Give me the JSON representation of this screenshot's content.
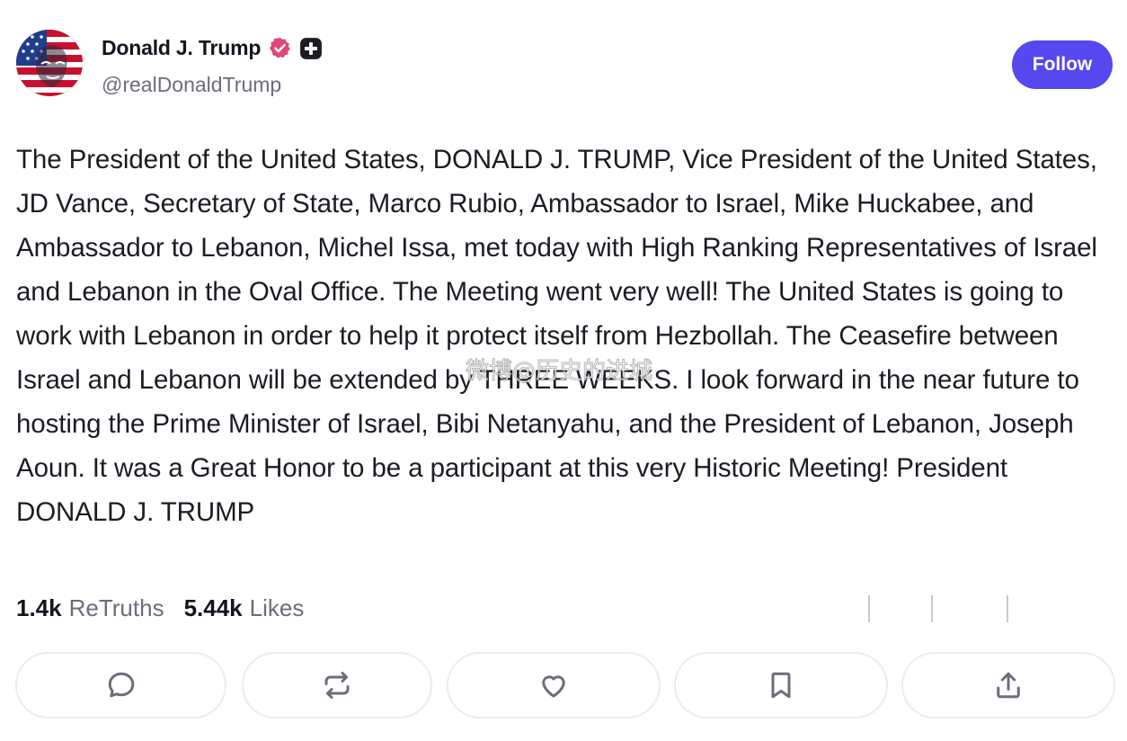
{
  "author": {
    "display_name": "Donald J. Trump",
    "handle": "@realDonaldTrump",
    "avatar_icon": "flag-portrait-avatar",
    "verified_icon": "verified-badge-icon",
    "verified_color": "#e0457b",
    "plus_badge_icon": "plus-badge-icon"
  },
  "follow": {
    "label": "Follow",
    "color": "#5448ee"
  },
  "post": {
    "text": "The President of the United States, DONALD J. TRUMP, Vice President of the United States, JD Vance, Secretary of State, Marco Rubio, Ambassador to Israel, Mike Huckabee, and Ambassador to Lebanon, Michel Issa, met today with High Ranking Representatives of Israel and Lebanon in the Oval Office. The Meeting went very well! The United States is going to work with Lebanon in order to help it protect itself from Hezbollah. The Ceasefire between Israel and Lebanon will be extended by THREE WEEKS. I look forward in the near future to hosting the Prime Minister of Israel, Bibi Netanyahu, and the President of Lebanon, Joseph Aoun. It was a Great Honor to be a participant at this very Historic Meeting! President DONALD J. TRUMP"
  },
  "watermark": {
    "text": "微博@历史的进城"
  },
  "stats": {
    "retruths_count": "1.4k",
    "retruths_label": "ReTruths",
    "likes_count": "5.44k",
    "likes_label": "Likes"
  },
  "actions": [
    {
      "name": "reply-button",
      "icon": "comment-icon"
    },
    {
      "name": "retruth-button",
      "icon": "repost-icon"
    },
    {
      "name": "like-button",
      "icon": "heart-icon"
    },
    {
      "name": "bookmark-button",
      "icon": "bookmark-icon"
    },
    {
      "name": "share-button",
      "icon": "share-icon"
    }
  ],
  "colors": {
    "text": "#1b1b24",
    "muted": "#6c6c7a",
    "icon": "#6c6c7a",
    "border": "#ececf1"
  }
}
